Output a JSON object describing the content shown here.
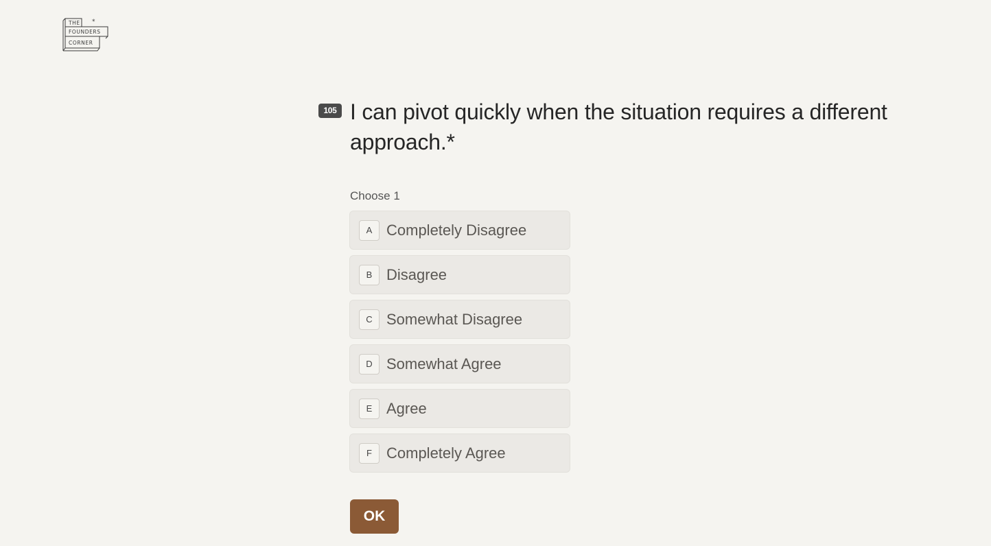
{
  "logo": {
    "line1": "THE",
    "line2": "FOUNDERS",
    "line3": "CORNER",
    "mark": "*"
  },
  "question": {
    "number": "105",
    "text": "I can pivot quickly when the situation requires a different approach.*",
    "hint": "Choose 1"
  },
  "options": [
    {
      "key": "A",
      "label": "Completely Disagree"
    },
    {
      "key": "B",
      "label": "Disagree"
    },
    {
      "key": "C",
      "label": "Somewhat Disagree"
    },
    {
      "key": "D",
      "label": "Somewhat Agree"
    },
    {
      "key": "E",
      "label": "Agree"
    },
    {
      "key": "F",
      "label": "Completely Agree"
    }
  ],
  "actions": {
    "ok_label": "OK"
  },
  "colors": {
    "background": "#f5f4f0",
    "accent": "#8b5a36",
    "option_bg": "#ebe9e5",
    "badge_bg": "#4a4a4a"
  }
}
